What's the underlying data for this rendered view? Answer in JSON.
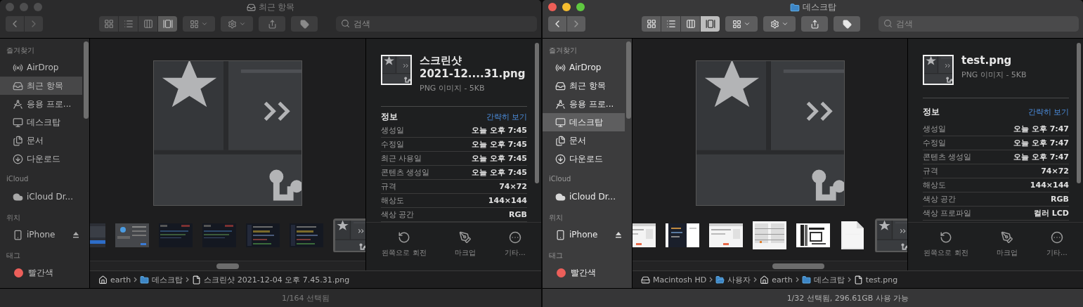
{
  "windows": [
    {
      "active": false,
      "title": "최근 항목",
      "kind": "recents",
      "search": {
        "placeholder": "검색"
      },
      "view_modes": [
        {
          "kind": "icons",
          "selected": false
        },
        {
          "kind": "list",
          "selected": false
        },
        {
          "kind": "columns",
          "selected": false
        },
        {
          "kind": "gallery",
          "selected": true
        }
      ],
      "sidebar": [
        {
          "heading": "즐겨찾기",
          "items": [
            {
              "label": "AirDrop",
              "kind": "airdrop",
              "selected": false
            },
            {
              "label": "최근 항목",
              "kind": "tray",
              "selected": true
            },
            {
              "label": "응용 프로...",
              "kind": "apps",
              "selected": false
            },
            {
              "label": "데스크탑",
              "kind": "desktop",
              "selected": false
            },
            {
              "label": "문서",
              "kind": "docs",
              "selected": false
            },
            {
              "label": "다운로드",
              "kind": "download",
              "selected": false
            }
          ]
        },
        {
          "heading": "iCloud",
          "items": [
            {
              "label": "iCloud Dr...",
              "kind": "cloud",
              "selected": false
            }
          ]
        },
        {
          "heading": "위치",
          "items": [
            {
              "label": "iPhone",
              "kind": "phone",
              "eject": true,
              "selected": false
            }
          ]
        },
        {
          "heading": "태그",
          "items": [
            {
              "label": "빨간색",
              "kind": "tag",
              "color": "#ec5f5a",
              "selected": false
            }
          ]
        }
      ],
      "thumbnails": [
        {
          "kind": "blue",
          "selected": false
        },
        {
          "kind": "dialog",
          "selected": false
        },
        {
          "kind": "dark",
          "selected": false
        },
        {
          "kind": "dark",
          "selected": false
        },
        {
          "kind": "code",
          "selected": false
        },
        {
          "kind": "code",
          "selected": false
        },
        {
          "kind": "icon",
          "selected": true
        }
      ],
      "info": {
        "name_lines": [
          "스크린샷",
          "2021-12....31.png"
        ],
        "type": "PNG 이미지 - 5KB",
        "heading": "정보",
        "link": "간략히 보기",
        "rows": [
          {
            "label": "생성일",
            "value": "오늘 오후 7:45"
          },
          {
            "label": "수정일",
            "value": "오늘 오후 7:45"
          },
          {
            "label": "최근 사용일",
            "value": "오늘 오후 7:45"
          },
          {
            "label": "콘텐츠 생성일",
            "value": "오늘 오후 7:45"
          },
          {
            "label": "규격",
            "value": "74×72"
          },
          {
            "label": "해상도",
            "value": "144×144"
          },
          {
            "label": "색상 공간",
            "value": "RGB"
          }
        ],
        "actions": [
          {
            "kind": "rotate",
            "label": "왼쪽으로 회전"
          },
          {
            "kind": "markup",
            "label": "마크업"
          },
          {
            "kind": "more",
            "label": "기타..."
          }
        ]
      },
      "path": [
        {
          "kind": "home",
          "label": "earth"
        },
        {
          "kind": "folder",
          "label": "데스크탑"
        },
        {
          "kind": "file",
          "label": "스크린샷 2021-12-04 오후 7.45.31.png"
        }
      ],
      "status": "1/164 선택됨"
    },
    {
      "active": true,
      "title": "데스크탑",
      "kind": "folder",
      "search": {
        "placeholder": "검색"
      },
      "view_modes": [
        {
          "kind": "icons",
          "selected": false
        },
        {
          "kind": "list",
          "selected": false
        },
        {
          "kind": "columns",
          "selected": false
        },
        {
          "kind": "gallery",
          "selected": true
        }
      ],
      "sidebar": [
        {
          "heading": "즐겨찾기",
          "items": [
            {
              "label": "AirDrop",
              "kind": "airdrop",
              "selected": false
            },
            {
              "label": "최근 항목",
              "kind": "tray",
              "selected": false
            },
            {
              "label": "응용 프로...",
              "kind": "apps",
              "selected": false
            },
            {
              "label": "데스크탑",
              "kind": "desktop",
              "selected": true
            },
            {
              "label": "문서",
              "kind": "docs",
              "selected": false
            },
            {
              "label": "다운로드",
              "kind": "download",
              "selected": false
            }
          ]
        },
        {
          "heading": "iCloud",
          "items": [
            {
              "label": "iCloud Dr...",
              "kind": "cloud",
              "selected": false
            }
          ]
        },
        {
          "heading": "위치",
          "items": [
            {
              "label": "iPhone",
              "kind": "phone",
              "eject": true,
              "selected": false
            }
          ]
        },
        {
          "heading": "태그",
          "items": [
            {
              "label": "빨간색",
              "kind": "tag",
              "color": "#ec5f5a",
              "selected": false
            }
          ]
        }
      ],
      "thumbnails": [
        {
          "kind": "light",
          "selected": false
        },
        {
          "kind": "split",
          "selected": false
        },
        {
          "kind": "light",
          "selected": false
        },
        {
          "kind": "table",
          "selected": false
        },
        {
          "kind": "layout",
          "selected": false
        },
        {
          "kind": "blank",
          "selected": false
        },
        {
          "kind": "icon",
          "selected": true
        }
      ],
      "info": {
        "name_lines": [
          "test.png"
        ],
        "type": "PNG 이미지 - 5KB",
        "heading": "정보",
        "link": "간략히 보기",
        "rows": [
          {
            "label": "생성일",
            "value": "오늘 오후 7:47"
          },
          {
            "label": "수정일",
            "value": "오늘 오후 7:47"
          },
          {
            "label": "콘텐츠 생성일",
            "value": "오늘 오후 7:47"
          },
          {
            "label": "규격",
            "value": "74×72"
          },
          {
            "label": "해상도",
            "value": "144×144"
          },
          {
            "label": "색상 공간",
            "value": "RGB"
          },
          {
            "label": "색상 프로파일",
            "value": "컬러 LCD"
          }
        ],
        "actions": [
          {
            "kind": "rotate",
            "label": "왼쪽으로 회전"
          },
          {
            "kind": "markup",
            "label": "마크업"
          },
          {
            "kind": "more",
            "label": "기타..."
          }
        ]
      },
      "path": [
        {
          "kind": "drive",
          "label": "Macintosh HD"
        },
        {
          "kind": "userfolder",
          "label": "사용자"
        },
        {
          "kind": "home",
          "label": "earth"
        },
        {
          "kind": "folder",
          "label": "데스크탑"
        },
        {
          "kind": "file",
          "label": "test.png"
        }
      ],
      "status": "1/32 선택됨, 296.61GB 사용 가능"
    }
  ]
}
